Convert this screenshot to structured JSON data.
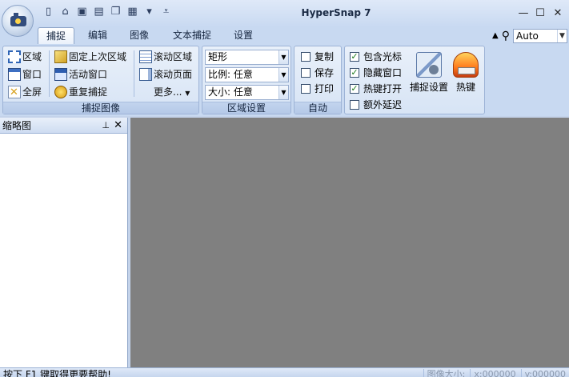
{
  "app": {
    "title": "HyperSnap 7"
  },
  "quick_access": [
    "new-icon",
    "open-icon",
    "save-icon",
    "print-icon",
    "copy-icon",
    "paste-icon",
    "dropdown-icon",
    "customize-icon"
  ],
  "tabs": [
    {
      "label": "捕捉",
      "active": true
    },
    {
      "label": "编辑",
      "active": false
    },
    {
      "label": "图像",
      "active": false
    },
    {
      "label": "文本捕捉",
      "active": false
    },
    {
      "label": "设置",
      "active": false
    }
  ],
  "right_controls": {
    "zoom_value": "Auto"
  },
  "ribbon": {
    "capture_group": {
      "label": "捕捉图像",
      "region": "区域",
      "window": "窗口",
      "fullscreen": "全屏",
      "fixed_region": "固定上次区域",
      "active_window": "活动窗口",
      "repeat": "重复捕捉",
      "scroll_region": "滚动区域",
      "scroll_page": "滚动页面",
      "more": "更多..."
    },
    "region_group": {
      "label": "区域设置",
      "shape": "矩形",
      "ratio": "比例: 任意",
      "size": "大小: 任意"
    },
    "auto_group": {
      "label": "自动",
      "copy": "复制",
      "save": "保存",
      "print": "打印"
    },
    "options_group": {
      "include_cursor": "包含光标",
      "hide_window": "隐藏窗口",
      "hotkey_open": "热键打开",
      "extra_delay": "额外延迟",
      "capture_settings": "捕捉设置",
      "hotkeys": "热键"
    }
  },
  "side_panel": {
    "title": "缩略图"
  },
  "status": {
    "help_text": "按下 F1 键取得更要帮助!",
    "image_size": "图像大小:",
    "x": "x:000000",
    "y": "y:000000"
  }
}
